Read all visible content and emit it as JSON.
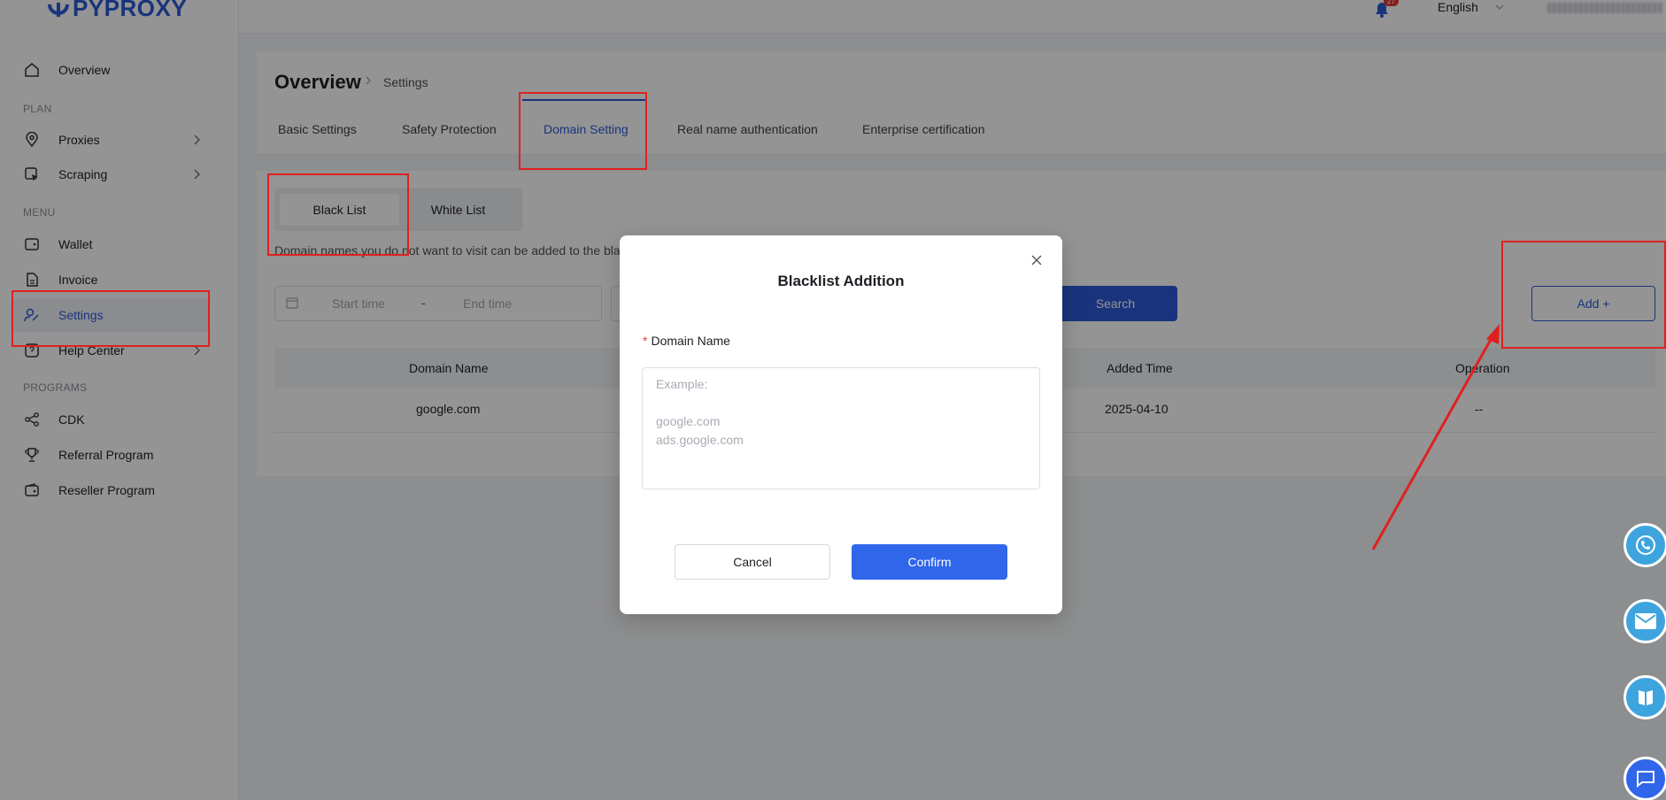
{
  "brand": {
    "logo_text": "PYPROXY"
  },
  "topbar": {
    "notification_count": "27",
    "language": "English"
  },
  "sidebar": {
    "sections": [
      "PLAN",
      "MENU",
      "PROGRAMS"
    ],
    "items": [
      {
        "label": "Overview",
        "icon": "home-icon"
      },
      {
        "label": "Proxies",
        "icon": "location-pin-icon"
      },
      {
        "label": "Scraping",
        "icon": "scraping-icon"
      },
      {
        "label": "Wallet",
        "icon": "wallet-icon"
      },
      {
        "label": "Invoice",
        "icon": "document-icon"
      },
      {
        "label": "Settings",
        "icon": "user-settings-icon"
      },
      {
        "label": "Help Center",
        "icon": "help-icon"
      },
      {
        "label": "CDK",
        "icon": "share-icon"
      },
      {
        "label": "Referral Program",
        "icon": "trophy-icon"
      },
      {
        "label": "Reseller Program",
        "icon": "wallet-icon"
      }
    ]
  },
  "page": {
    "title": "Overview",
    "breadcrumb_sub": "Settings",
    "tabs": [
      "Basic Settings",
      "Safety Protection",
      "Domain Setting",
      "Real name authentication",
      "Enterprise certification"
    ],
    "active_tab": "Domain Setting"
  },
  "content": {
    "segment": {
      "black": "Black List",
      "white": "White List"
    },
    "description": "Domain names you do not want to visit can be added to the blackl",
    "filters": {
      "start_placeholder": "Start time",
      "separator": "-",
      "end_placeholder": "End time"
    },
    "search_label": "Search",
    "add_label": "Add +",
    "table": {
      "headers": [
        "Domain Name",
        "Added Time",
        "Operation"
      ],
      "rows": [
        [
          "google.com",
          "2025-04-10",
          "--"
        ]
      ]
    }
  },
  "modal": {
    "title": "Blacklist Addition",
    "close": "×",
    "required_mark": "*",
    "field_label": "Domain Name",
    "placeholder": "Example:\n\ngoogle.com\nads.google.com",
    "cancel": "Cancel",
    "confirm": "Confirm"
  },
  "colors": {
    "accent": "#2c5bd8",
    "annotation": "#e02020",
    "confirm": "#2f66ea",
    "float": "#3ea4de"
  }
}
